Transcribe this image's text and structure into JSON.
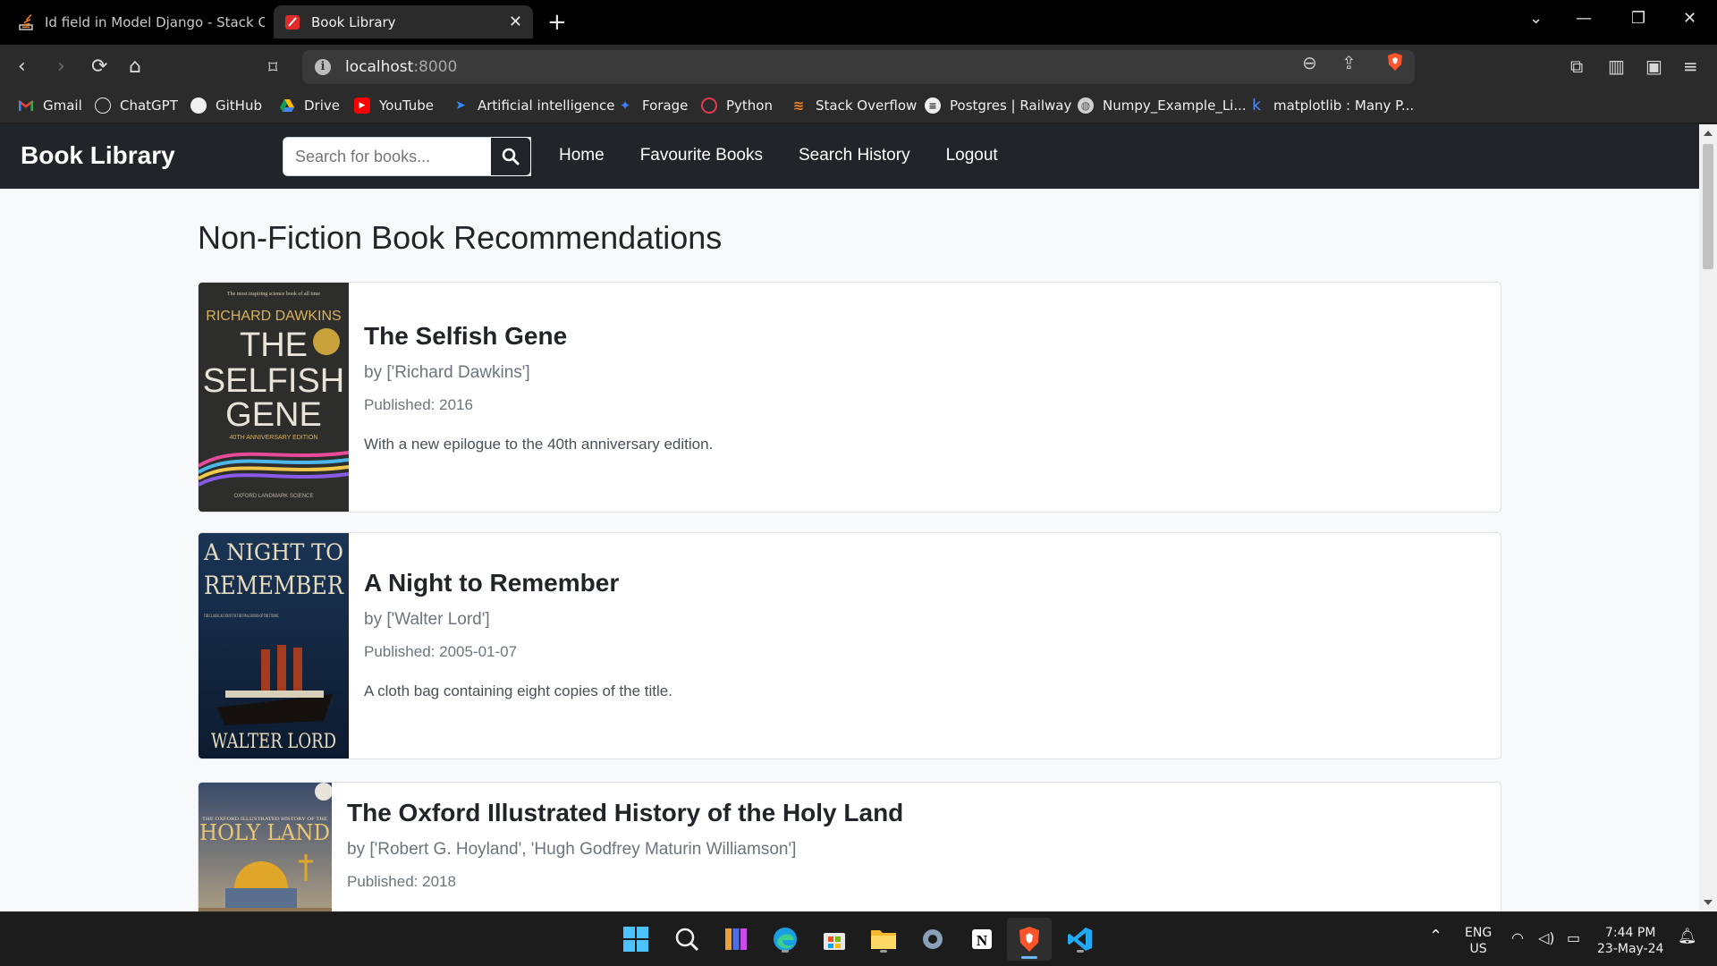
{
  "browser": {
    "tabs": [
      {
        "title": "Id field in Model Django - Stack Ove",
        "active": false
      },
      {
        "title": "Book Library",
        "active": true
      }
    ],
    "address": {
      "host": "localhost",
      "port": ":8000"
    },
    "bookmarks": [
      {
        "label": "Gmail",
        "icon": "gmail-icon"
      },
      {
        "label": "ChatGPT",
        "icon": "chatgpt-icon"
      },
      {
        "label": "GitHub",
        "icon": "github-icon"
      },
      {
        "label": "Drive",
        "icon": "drive-icon"
      },
      {
        "label": "YouTube",
        "icon": "youtube-icon"
      },
      {
        "label": "Artificial intelligence",
        "icon": "ai-icon"
      },
      {
        "label": "Forage",
        "icon": "forage-icon"
      },
      {
        "label": "Python",
        "icon": "python-icon"
      },
      {
        "label": "Stack Overflow",
        "icon": "stackoverflow-icon"
      },
      {
        "label": "Postgres | Railway",
        "icon": "railway-icon"
      },
      {
        "label": "Numpy_Example_Li...",
        "icon": "globe-icon"
      },
      {
        "label": "matplotlib : Many P...",
        "icon": "k-icon"
      }
    ]
  },
  "site": {
    "brand": "Book Library",
    "search_placeholder": "Search for books...",
    "nav": [
      "Home",
      "Favourite Books",
      "Search History",
      "Logout"
    ],
    "heading": "Non-Fiction Book Recommendations",
    "books": [
      {
        "title": "The Selfish Gene",
        "author": "by ['Richard Dawkins']",
        "published": "Published: 2016",
        "description": "With a new epilogue to the 40th anniversary edition.",
        "cover": {
          "tagline": "The most inspiring science book of all time",
          "author": "RICHARD DAWKINS",
          "line1": "THE",
          "line2": "SELFISH",
          "line3": "GENE",
          "edition": "40TH ANNIVERSARY EDITION",
          "series": "OXFORD LANDMARK SCIENCE"
        }
      },
      {
        "title": "A Night to Remember",
        "author": "by ['Walter Lord']",
        "published": "Published: 2005-01-07",
        "description": "A cloth bag containing eight copies of the title.",
        "cover": {
          "line1": "A NIGHT TO",
          "line2": "REMEMBER",
          "subtitle": "THE CLASSIC ACCOUNT OF THE FINAL HOURS OF THE TITANIC",
          "author": "WALTER LORD"
        }
      },
      {
        "title": "The Oxford Illustrated History of the Holy Land",
        "author": "by ['Robert G. Hoyland', 'Hugh Godfrey Maturin Williamson']",
        "published": "Published: 2018",
        "description": "",
        "cover": {
          "small": "THE OXFORD ILLUSTRATED HISTORY OF THE",
          "big": "HOLY LAND"
        }
      }
    ]
  },
  "taskbar": {
    "lang": "ENG",
    "region": "US",
    "time": "7:44 PM",
    "date": "23-May-24"
  },
  "colors": {
    "navbar": "#212529",
    "page_bg": "#f8f9fa",
    "card_border": "#dee2e6"
  }
}
